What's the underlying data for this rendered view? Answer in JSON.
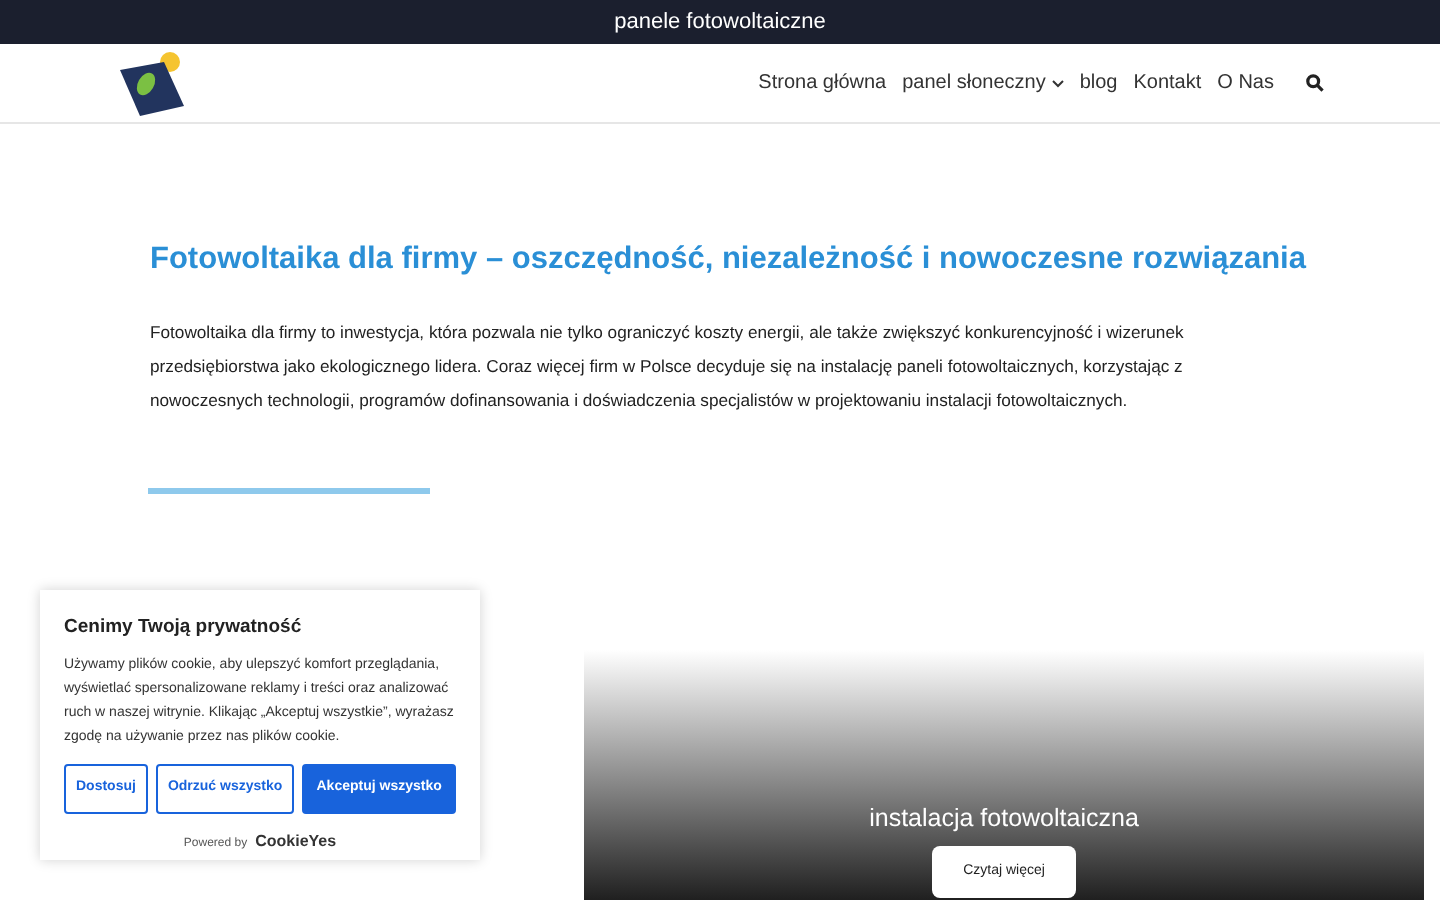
{
  "top_bar": {
    "title": "panele fotowoltaiczne"
  },
  "nav": {
    "items": [
      {
        "label": "Strona główna",
        "dropdown": false
      },
      {
        "label": "panel słoneczny",
        "dropdown": true
      },
      {
        "label": "blog",
        "dropdown": false
      },
      {
        "label": "Kontakt",
        "dropdown": false
      },
      {
        "label": "O Nas",
        "dropdown": false
      }
    ]
  },
  "article": {
    "heading": "Fotowoltaika dla firmy – oszczędność, niezależność i nowoczesne rozwiązania",
    "paragraph": "Fotowoltaika dla firmy to inwestycja, która pozwala nie tylko ograniczyć koszty energii, ale także zwiększyć konkurencyjność i wizerunek przedsiębiorstwa jako ekologicznego lidera. Coraz więcej firm w Polsce decyduje się na instalację paneli fotowoltaicznych, korzystając z nowoczesnych technologii, programów dofinansowania i doświadczenia specjalistów w projektowaniu instalacji fotowoltaicznych."
  },
  "post_card": {
    "title": "instalacja fotowoltaiczna",
    "button": "Czytaj więcej"
  },
  "cookie_banner": {
    "title": "Cenimy Twoją prywatność",
    "text": "Używamy plików cookie, aby ulepszyć komfort przeglądania, wyświetlać spersonalizowane reklamy i treści oraz analizować ruch w naszej witrynie. Klikając „Akceptuj wszystkie”, wyrażasz zgodę na używanie przez nas plików cookie.",
    "buttons": [
      {
        "label": "Dostosuj",
        "kind": "outline"
      },
      {
        "label": "Odrzuć wszystko",
        "kind": "outline"
      },
      {
        "label": "Akceptuj wszystko",
        "kind": "primary"
      }
    ],
    "powered_by": "Powered by",
    "brand": "CookieYes"
  }
}
